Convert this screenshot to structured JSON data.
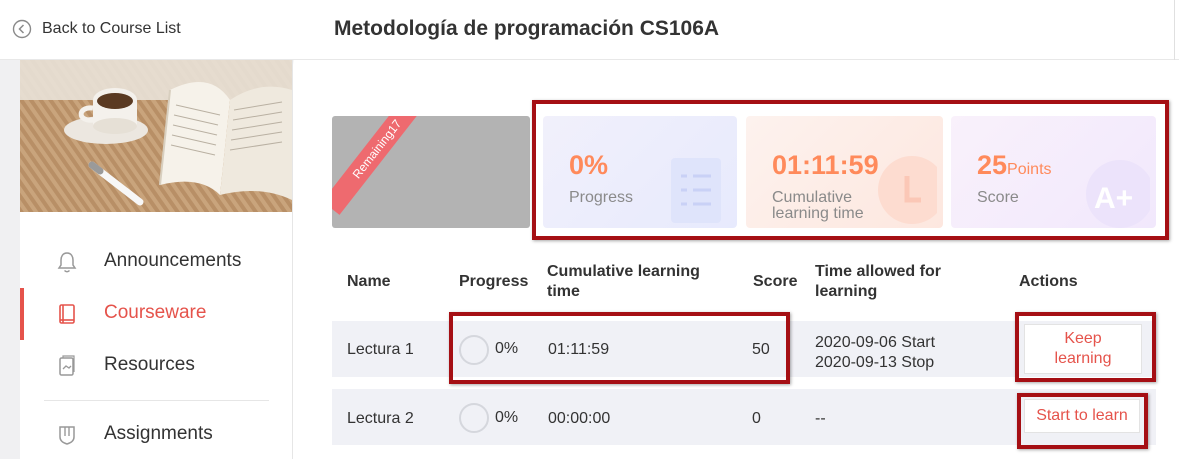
{
  "header": {
    "back_label": "Back to Course List",
    "course_title": "Metodología de programación CS106A"
  },
  "sidebar": {
    "items": [
      {
        "label": "Announcements",
        "icon": "bell-icon"
      },
      {
        "label": "Courseware",
        "icon": "book-icon",
        "active": true
      },
      {
        "label": "Resources",
        "icon": "folder-icon"
      },
      {
        "label": "Assignments",
        "icon": "shield-icon"
      }
    ]
  },
  "course_card": {
    "ribbon": "Remaining17"
  },
  "stats": {
    "progress": {
      "value": "0%",
      "caption": "Progress"
    },
    "time": {
      "value": "01:11:59",
      "caption_line1": "Cumulative",
      "caption_line2": "learning time"
    },
    "score": {
      "value": "25",
      "unit": "Points",
      "caption": "Score"
    }
  },
  "table": {
    "headers": {
      "name": "Name",
      "progress": "Progress",
      "time_line1": "Cumulative learning",
      "time_line2": "time",
      "score": "Score",
      "allowed_line1": "Time allowed for",
      "allowed_line2": "learning",
      "actions": "Actions"
    },
    "rows": [
      {
        "name": "Lectura 1",
        "progress": "0%",
        "time": "01:11:59",
        "score": "50",
        "allowed_line1": "2020-09-06 Start",
        "allowed_line2": "2020-09-13 Stop",
        "action_line1": "Keep",
        "action_line2": "learning"
      },
      {
        "name": "Lectura 2",
        "progress": "0%",
        "time": "00:00:00",
        "score": "0",
        "allowed_line1": "--",
        "action_line1": "Start to learn"
      }
    ]
  },
  "colors": {
    "accent": "#e5534b",
    "stat_value": "#ff8a5b",
    "highlight_box": "#a50f14"
  }
}
